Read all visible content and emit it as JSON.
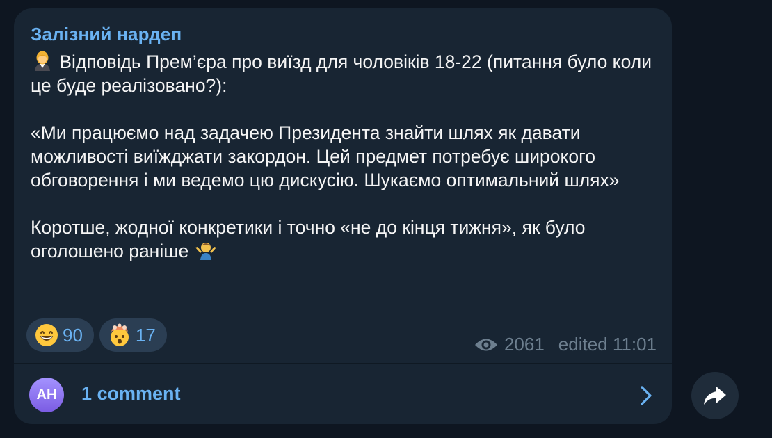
{
  "post": {
    "channel_name": "Залізний нардеп",
    "paragraph1": "Відповідь Прем’єра про виїзд для чоловіків 18-22 (питання було коли це буде реалізовано?):",
    "paragraph1_emoji": "woman-office-worker-emoji",
    "paragraph2": "«Ми працюємо над задачею Президента знайти шлях як давати можливості виїжджати закордон. Цей предмет потребує широкого обговорення і ми ведемо цю дискусію. Шукаємо оптимальний шлях»",
    "paragraph3": "Коротше, жодної конкретики і точно «не до кінця тижня», як було оголошено раніше",
    "paragraph3_emoji": "man-shrugging-emoji"
  },
  "reactions": [
    {
      "icon": "grinning-face-emoji",
      "count": "90"
    },
    {
      "icon": "exploding-head-emoji",
      "count": "17"
    }
  ],
  "meta": {
    "views_icon": "eye-icon",
    "views": "2061",
    "edited": "edited 11:01"
  },
  "comments": {
    "avatar_initials": "AH",
    "label": "1 comment",
    "chevron_icon": "chevron-right-icon"
  },
  "share": {
    "icon": "share-arrow-icon"
  },
  "colors": {
    "background": "#0e1621",
    "bubble": "#182533",
    "accent": "#6ab2f2",
    "text": "#f5f5f5",
    "muted": "#6d7f8f",
    "reaction_bg": "#2b3e53",
    "avatar": "#8a6cf0"
  }
}
